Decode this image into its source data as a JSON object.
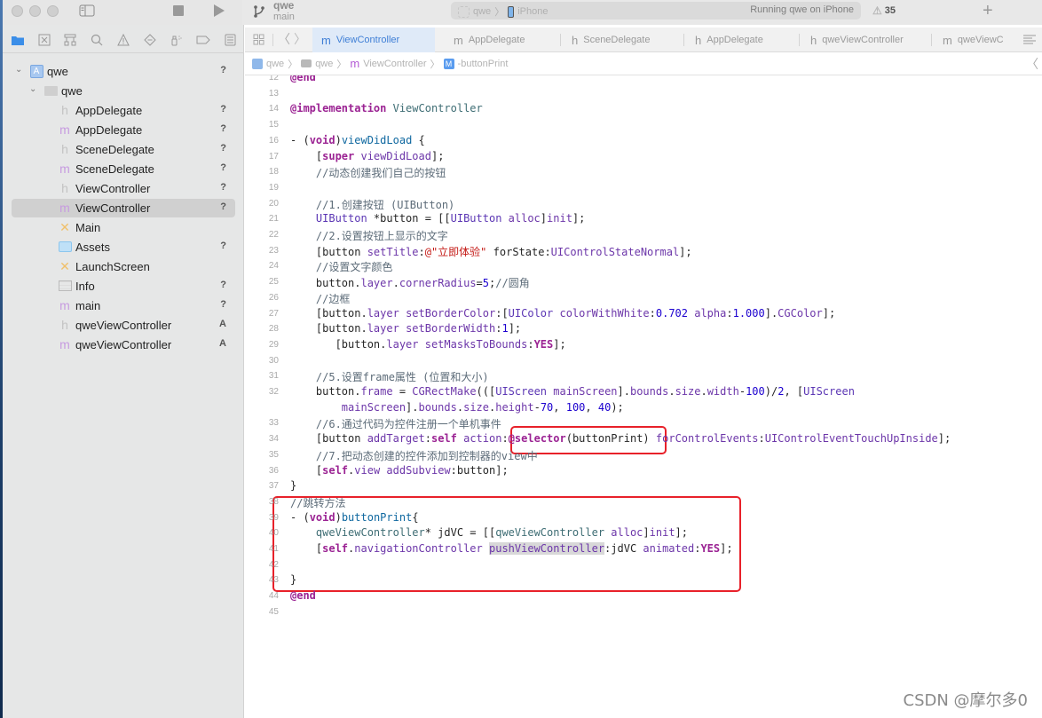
{
  "toolbar": {
    "scheme_name": "qwe",
    "branch": "main",
    "target_scheme": "qwe",
    "target_device": "iPhone",
    "status": "Running qwe on iPhone",
    "warning_count": "35",
    "add_label": "+"
  },
  "navigator": {
    "tabs": [
      "project-navigator",
      "source-control",
      "symbol-navigator",
      "find-navigator",
      "issue-navigator",
      "test-navigator",
      "debug-navigator",
      "breakpoint-navigator",
      "report-navigator"
    ],
    "items": [
      {
        "label": "qwe",
        "type": "project",
        "badge": "?",
        "level": 0,
        "expanded": true
      },
      {
        "label": "qwe",
        "type": "folder",
        "badge": "",
        "level": 1,
        "expanded": true
      },
      {
        "label": "AppDelegate",
        "type": "h",
        "badge": "?",
        "level": 2
      },
      {
        "label": "AppDelegate",
        "type": "m",
        "badge": "?",
        "level": 2
      },
      {
        "label": "SceneDelegate",
        "type": "h",
        "badge": "?",
        "level": 2
      },
      {
        "label": "SceneDelegate",
        "type": "m",
        "badge": "?",
        "level": 2
      },
      {
        "label": "ViewController",
        "type": "h",
        "badge": "?",
        "level": 2
      },
      {
        "label": "ViewController",
        "type": "m",
        "badge": "?",
        "level": 2,
        "selected": true
      },
      {
        "label": "Main",
        "type": "storyboard",
        "badge": "",
        "level": 2
      },
      {
        "label": "Assets",
        "type": "assets",
        "badge": "?",
        "level": 2
      },
      {
        "label": "LaunchScreen",
        "type": "storyboard",
        "badge": "",
        "level": 2
      },
      {
        "label": "Info",
        "type": "plist",
        "badge": "?",
        "level": 2
      },
      {
        "label": "main",
        "type": "m",
        "badge": "?",
        "level": 2
      },
      {
        "label": "qweViewController",
        "type": "h",
        "badge": "A",
        "level": 2
      },
      {
        "label": "qweViewController",
        "type": "m",
        "badge": "A",
        "level": 2
      }
    ]
  },
  "editor": {
    "tabs": [
      {
        "type": "m",
        "label": "ViewController",
        "active": true
      },
      {
        "type": "m",
        "label": "AppDelegate"
      },
      {
        "type": "h",
        "label": "SceneDelegate"
      },
      {
        "type": "h",
        "label": "AppDelegate"
      },
      {
        "type": "h",
        "label": "qweViewController"
      },
      {
        "type": "m",
        "label": "qweViewC"
      }
    ],
    "breadcrumb": [
      "qwe",
      "qwe",
      "ViewController",
      "-buttonPrint"
    ],
    "lines": [
      {
        "n": "12",
        "html": "<span class='kw'>@end</span>"
      },
      {
        "n": "13",
        "html": ""
      },
      {
        "n": "14",
        "html": "<span class='kw'>@implementation</span> <span class='cls'>ViewController</span>"
      },
      {
        "n": "15",
        "html": ""
      },
      {
        "n": "16",
        "html": "- (<span class='kw'>void</span>)<span class='fn'>viewDidLoad</span> {"
      },
      {
        "n": "17",
        "html": "    [<span class='kw'>super</span> <span class='prop'>viewDidLoad</span>];"
      },
      {
        "n": "18",
        "html": "    <span class='cmt'>//动态创建我们自己的按钮</span>"
      },
      {
        "n": "19",
        "html": ""
      },
      {
        "n": "20",
        "html": "    <span class='cmt'>//1.创建按钮 (UIButton)</span>"
      },
      {
        "n": "21",
        "html": "    <span class='typ'>UIButton</span> *button = [[<span class='typ'>UIButton</span> <span class='prop'>alloc</span>]<span class='prop'>init</span>];"
      },
      {
        "n": "22",
        "html": "    <span class='cmt'>//2.设置按钮上显示的文字</span>"
      },
      {
        "n": "23",
        "html": "    [button <span class='prop'>setTitle</span>:<span class='str'>@\"立即体验\"</span> forState:<span class='prop'>UIControlStateNormal</span>];"
      },
      {
        "n": "24",
        "html": "    <span class='cmt'>//设置文字颜色</span>"
      },
      {
        "n": "25",
        "html": "    button.<span class='prop'>layer</span>.<span class='prop'>cornerRadius</span>=<span class='num-lit'>5</span>;<span class='cmt'>//圆角</span>"
      },
      {
        "n": "26",
        "html": "    <span class='cmt'>//边框</span>"
      },
      {
        "n": "27",
        "html": "    [button.<span class='prop'>layer</span> <span class='prop'>setBorderColor</span>:[<span class='typ'>UIColor</span> <span class='prop'>colorWithWhite</span>:<span class='num-lit'>0.702</span> <span class='prop'>alpha</span>:<span class='num-lit'>1.000</span>].<span class='prop'>CGColor</span>];"
      },
      {
        "n": "28",
        "html": "    [button.<span class='prop'>layer</span> <span class='prop'>setBorderWidth</span>:<span class='num-lit'>1</span>];"
      },
      {
        "n": "29",
        "html": "       [button.<span class='prop'>layer</span> <span class='prop'>setMasksToBounds</span>:<span class='kw'>YES</span>];"
      },
      {
        "n": "30",
        "html": ""
      },
      {
        "n": "31",
        "html": "    <span class='cmt'>//5.设置frame属性 (位置和大小)</span>"
      },
      {
        "n": "32",
        "html": "    button.<span class='prop'>frame</span> = <span class='prop'>CGRectMake</span>(([<span class='typ'>UIScreen</span> <span class='prop'>mainScreen</span>].<span class='prop'>bounds</span>.<span class='prop'>size</span>.<span class='prop'>width</span>-<span class='num-lit'>100</span>)/<span class='num-lit'>2</span>, [<span class='typ'>UIScreen</span>"
      },
      {
        "n": "",
        "html": "        <span class='prop'>mainScreen</span>].<span class='prop'>bounds</span>.<span class='prop'>size</span>.<span class='prop'>height</span>-<span class='num-lit'>70</span>, <span class='num-lit'>100</span>, <span class='num-lit'>40</span>);"
      },
      {
        "n": "33",
        "html": "    <span class='cmt'>//6.通过代码为控件注册一个单机事件</span>"
      },
      {
        "n": "34",
        "html": "    [button <span class='prop'>addTarget</span>:<span class='kw'>self</span> <span class='prop'>action</span>:<span class='kw'>@selector</span>(buttonPrint) <span class='prop'>forControlEvents</span>:<span class='prop'>UIControlEventTouchUpInside</span>];"
      },
      {
        "n": "35",
        "html": "    <span class='cmt'>//7.把动态创建的控件添加到控制器的view中</span>"
      },
      {
        "n": "36",
        "html": "    [<span class='kw'>self</span>.<span class='prop'>view</span> <span class='prop'>addSubview</span>:button];"
      },
      {
        "n": "37",
        "html": "}"
      },
      {
        "n": "38",
        "html": "<span class='cmt'>//跳转方法</span>"
      },
      {
        "n": "39",
        "html": "- (<span class='kw'>void</span>)<span class='fn'>buttonPrint</span>{"
      },
      {
        "n": "40",
        "html": "    <span class='cls'>qweViewController</span>* jdVC = [[<span class='cls'>qweViewController</span> <span class='prop'>alloc</span>]<span class='prop'>init</span>];"
      },
      {
        "n": "41",
        "html": "    [<span class='kw'>self</span>.<span class='prop'>navigationController</span> <span class='prop hl'>pushViewController</span>:jdVC <span class='prop'>animated</span>:<span class='kw'>YES</span>];"
      },
      {
        "n": "42",
        "html": ""
      },
      {
        "n": "43",
        "html": "}"
      },
      {
        "n": "44",
        "html": "<span class='kw'>@end</span>"
      },
      {
        "n": "45",
        "html": ""
      }
    ]
  },
  "watermark": "CSDN @摩尔多0",
  "colors": {
    "accent": "#3f7fd6",
    "annotation_red": "#e8212a",
    "keyword": "#9b2393"
  }
}
